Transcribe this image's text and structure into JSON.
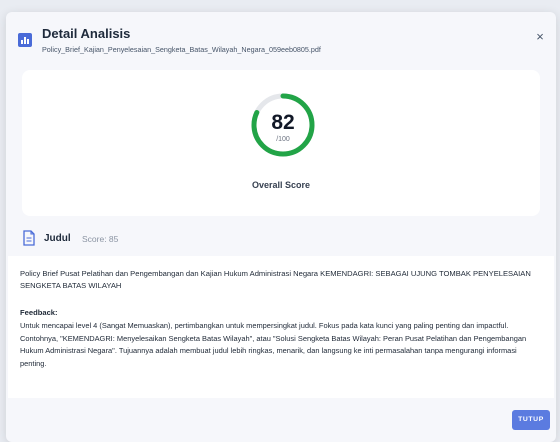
{
  "header": {
    "title": "Detail Analisis",
    "filename": "Policy_Brief_Kajian_Penyelesaian_Sengketa_Batas_Wilayah_Negara_059eeb0805.pdf",
    "icon": "chart-icon",
    "close_label": "×"
  },
  "score": {
    "value": "82",
    "max_label": "/100",
    "fraction": 0.82,
    "label": "Overall Score",
    "ring_color": "#22a447",
    "track_color": "#e5e7eb"
  },
  "section": {
    "title": "Judul",
    "score_label": "Score: 85",
    "icon": "document-icon"
  },
  "content": {
    "judul": "Policy Brief Pusat Pelatihan dan Pengembangan dan Kajian Hukum Administrasi Negara KEMENDAGRI: SEBAGAI UJUNG TOMBAK PENYELESAIAN SENGKETA BATAS WILAYAH",
    "feedback_label": "Feedback:",
    "feedback": "Untuk mencapai level 4 (Sangat Memuaskan), pertimbangkan untuk mempersingkat judul. Fokus pada kata kunci yang paling penting dan impactful. Contohnya, \"KEMENDAGRI: Menyelesaikan Sengketa Batas Wilayah\", atau \"Solusi Sengketa Batas Wilayah: Peran Pusat Pelatihan dan Pengembangan Hukum Administrasi Negara\". Tujuannya adalah membuat judul lebih ringkas, menarik, dan langsung ke inti permasalahan tanpa mengurangi informasi penting."
  },
  "footer": {
    "close_button": "TUTUP",
    "accent": "#5b7be0"
  }
}
